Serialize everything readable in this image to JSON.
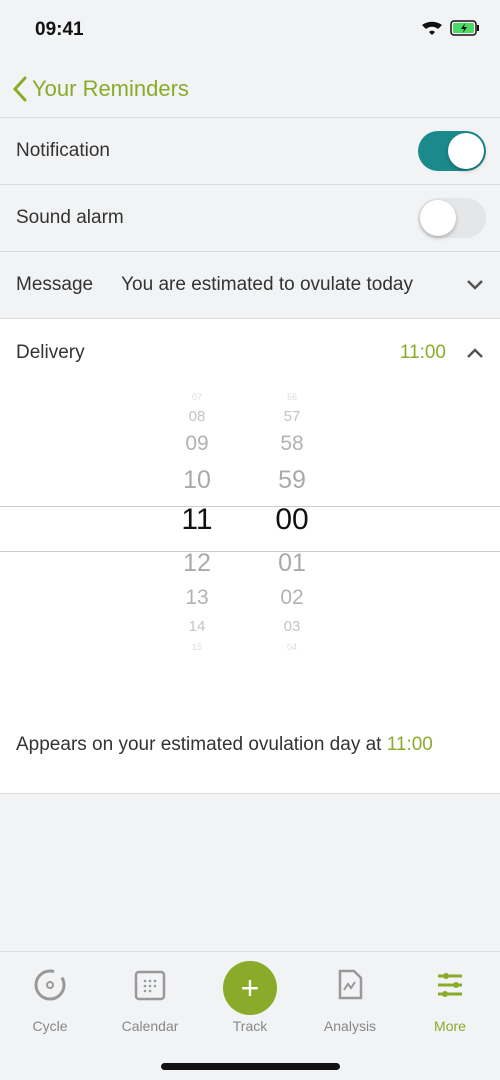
{
  "status": {
    "time": "09:41"
  },
  "nav": {
    "back_label": "Your Reminders"
  },
  "settings": {
    "notification": {
      "label": "Notification",
      "on": true
    },
    "sound": {
      "label": "Sound alarm",
      "on": false
    },
    "message": {
      "label": "Message",
      "value": "You are estimated to ovulate today"
    },
    "delivery": {
      "label": "Delivery",
      "value": "11:00"
    }
  },
  "picker": {
    "hours": [
      "07",
      "08",
      "09",
      "10",
      "11",
      "12",
      "13",
      "14",
      "15"
    ],
    "minutes": [
      "56",
      "57",
      "58",
      "59",
      "00",
      "01",
      "02",
      "03",
      "04"
    ],
    "selected_hour": "11",
    "selected_minute": "00"
  },
  "note": {
    "text": "Appears on your estimated ovulation day at ",
    "time": "11:00"
  },
  "tabs": [
    {
      "label": "Cycle",
      "icon": "cycle-icon"
    },
    {
      "label": "Calendar",
      "icon": "calendar-icon"
    },
    {
      "label": "Track",
      "icon": "plus-icon"
    },
    {
      "label": "Analysis",
      "icon": "analysis-icon"
    },
    {
      "label": "More",
      "icon": "sliders-icon",
      "active": true
    }
  ],
  "colors": {
    "accent": "#8aab2a",
    "toggle_on": "#1b8a8c"
  }
}
